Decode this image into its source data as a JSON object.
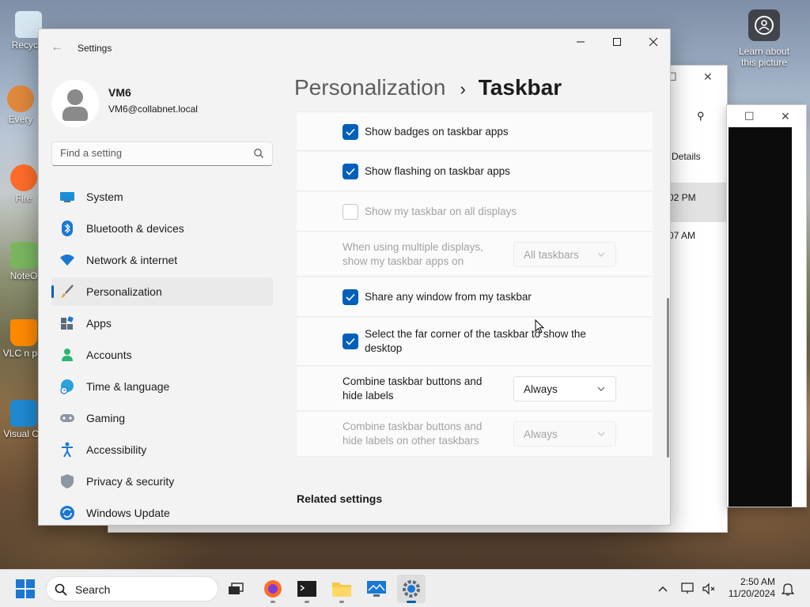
{
  "desktop": {
    "icons": [
      {
        "label": "Recycle",
        "color": "#cfe3ef"
      },
      {
        "label": "Every",
        "color": "#e0893b"
      },
      {
        "label": "Fire",
        "color": "#ff6d2b"
      },
      {
        "label": "NoteO",
        "color": "#7bb661"
      },
      {
        "label": "VLC n pla",
        "color": "#ff8a00"
      },
      {
        "label": "Visual Co",
        "color": "#1f8ad2"
      }
    ],
    "learn_about": "Learn about this picture"
  },
  "explorer": {
    "details_label": "Details",
    "time1": "02 PM",
    "time2": "07 AM"
  },
  "settings": {
    "app_title": "Settings",
    "user": {
      "name": "VM6",
      "email": "VM6@collabnet.local"
    },
    "search_placeholder": "Find a setting",
    "nav": [
      {
        "label": "System",
        "icon": "monitor-icon"
      },
      {
        "label": "Bluetooth & devices",
        "icon": "bluetooth-icon"
      },
      {
        "label": "Network & internet",
        "icon": "wifi-icon"
      },
      {
        "label": "Personalization",
        "icon": "brush-icon",
        "active": true
      },
      {
        "label": "Apps",
        "icon": "apps-icon"
      },
      {
        "label": "Accounts",
        "icon": "accounts-icon"
      },
      {
        "label": "Time & language",
        "icon": "globe-clock-icon"
      },
      {
        "label": "Gaming",
        "icon": "gamepad-icon"
      },
      {
        "label": "Accessibility",
        "icon": "accessibility-icon"
      },
      {
        "label": "Privacy & security",
        "icon": "shield-icon"
      },
      {
        "label": "Windows Update",
        "icon": "update-icon"
      }
    ],
    "breadcrumb": {
      "parent": "Personalization",
      "separator": "›",
      "current": "Taskbar"
    },
    "rows": {
      "badges": {
        "label": "Show badges on taskbar apps",
        "checked": true
      },
      "flashing": {
        "label": "Show flashing on taskbar apps",
        "checked": true
      },
      "all_displays": {
        "label": "Show my taskbar on all displays",
        "checked": false,
        "disabled": true
      },
      "multi_display": {
        "label_line1": "When using multiple displays,",
        "label_line2": "show my taskbar apps on",
        "value": "All taskbars",
        "disabled": true
      },
      "share_window": {
        "label": "Share any window from my taskbar",
        "checked": true
      },
      "far_corner": {
        "label_line1": "Select the far corner of the taskbar to show the",
        "label_line2": "desktop",
        "checked": true
      },
      "combine": {
        "label_line1": "Combine taskbar buttons and",
        "label_line2": "hide labels",
        "value": "Always"
      },
      "combine_other": {
        "label_line1": "Combine taskbar buttons and",
        "label_line2": "hide labels on other taskbars",
        "value": "Always",
        "disabled": true
      }
    },
    "related_settings": "Related settings",
    "accent": "#005fb8"
  },
  "taskbar": {
    "search_label": "Search",
    "apps": [
      "task-view-icon",
      "firefox-icon",
      "terminal-icon",
      "file-explorer-icon",
      "monitor-app-icon",
      "settings-icon"
    ],
    "time": "2:50 AM",
    "date": "11/20/2024"
  }
}
